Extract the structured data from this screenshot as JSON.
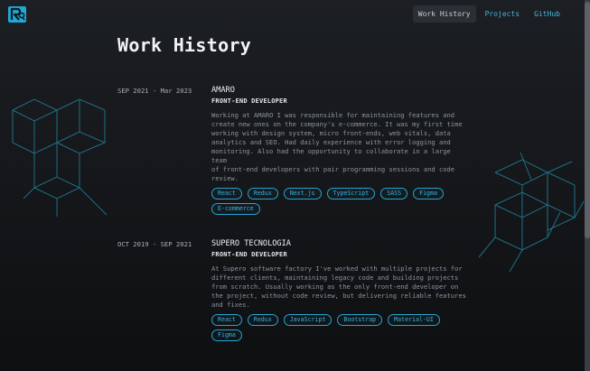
{
  "logo": {
    "icon": "rq-logo-icon"
  },
  "nav": {
    "items": [
      {
        "label": "Work History",
        "active": true
      },
      {
        "label": "Projects",
        "active": false
      },
      {
        "label": "GitHub",
        "active": false
      }
    ]
  },
  "page": {
    "title": "Work History"
  },
  "jobs": [
    {
      "dates": "SEP 2021 - Mar 2023",
      "company": "AMARO",
      "role": "FRONT-END DEVELOPER",
      "description": "Working at AMARO I was responsible for maintaining features and\ncreate new ones on the company's e-commerce. It was my first time\nworking with design system, micro front-ends, web vitals, data\nanalytics and SEO. Had daily experience with error logging and\nmonitoring. Also had the opportunity to collaborate in a large team\nof front-end developers with pair programming sessions and code\nreview.",
      "tags": [
        "React",
        "Redux",
        "Next.js",
        "TypeScript",
        "SASS",
        "Figma",
        "E-commerce"
      ]
    },
    {
      "dates": "OCT 2019 - SEP 2021",
      "company": "SUPERO TECNOLOGIA",
      "role": "FRONT-END DEVELOPER",
      "description": "At Supero software factory I've worked with multiple projects for\ndifferent clients, maintaining legacy code and building projects\nfrom scratch. Usually working as the only front-end developer on\nthe project, without code review, but delivering reliable features\nand fixes.",
      "tags": [
        "React",
        "Redux",
        "JavaScript",
        "Bootstrap",
        "Material-UI",
        "Figma"
      ]
    }
  ],
  "colors": {
    "accent": "#3fb8e2",
    "background": "#16181b",
    "decoration": "#1f6f86"
  }
}
